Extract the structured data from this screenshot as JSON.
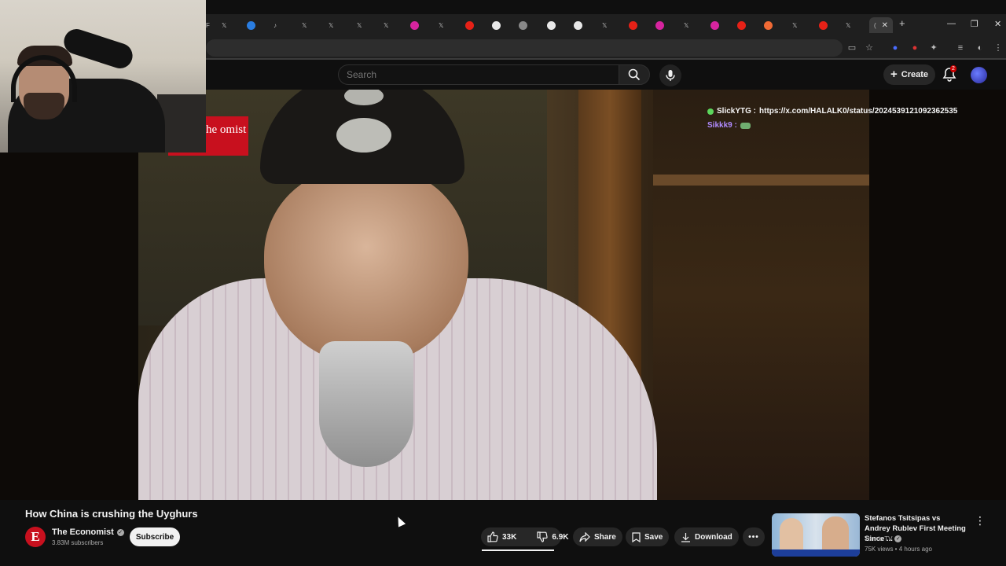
{
  "search": {
    "placeholder": "Search"
  },
  "masthead": {
    "create_label": "Create",
    "notification_count": "2"
  },
  "chat": {
    "messages": [
      {
        "user": "SlickYTG :",
        "text": "https://x.com/HALALK0/status/2024539121092362535"
      },
      {
        "user": "Sikkk9 :",
        "text": ""
      }
    ]
  },
  "video": {
    "badge_text": "he omist",
    "title": "How China is crushing the Uyghurs"
  },
  "channel": {
    "logo_letter": "E",
    "name": "The Economist",
    "subscribers": "3.83M subscribers",
    "subscribe_label": "Subscribe"
  },
  "actions": {
    "likes": "33K",
    "dislikes": "6.9K",
    "share": "Share",
    "save": "Save",
    "download": "Download"
  },
  "recommended": {
    "title": "Stefanos Tsitsipas vs Andrey Rublev First Meeting Since ...",
    "channel": "Tennis TV",
    "meta": "75K views • 4 hours ago"
  },
  "colors": {
    "accent": "#c8101e",
    "background": "#0f0f0f",
    "chat_user2": "#b08bff"
  }
}
